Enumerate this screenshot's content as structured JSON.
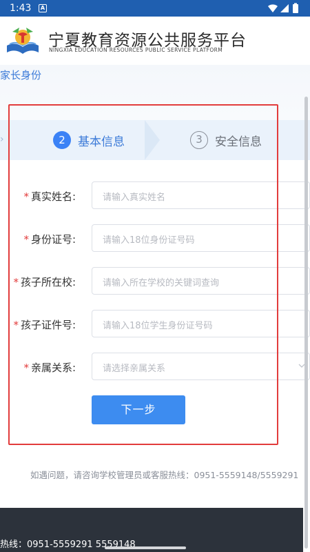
{
  "status_bar": {
    "time": "1:43",
    "notif_icon": "A"
  },
  "header": {
    "title": "宁夏教育资源公共服务平台",
    "subtitle": "NINGXIA EDUCATION RESOURCES PUBLIC SERVICE PLATFORM"
  },
  "breadcrumb": "家长身份",
  "steps": [
    {
      "number": "2",
      "label": "基本信息",
      "active": true
    },
    {
      "number": "3",
      "label": "安全信息",
      "active": false
    }
  ],
  "form": {
    "fields": [
      {
        "label": "真实姓名:",
        "placeholder": "请输入真实姓名",
        "required": true
      },
      {
        "label": "身份证号:",
        "placeholder": "请输入18位身份证号码",
        "required": true
      },
      {
        "label": "孩子所在校:",
        "placeholder": "请输入所在学校的关键词查询",
        "required": true
      },
      {
        "label": "孩子证件号:",
        "placeholder": "请输入18位学生身份证号码",
        "required": true
      },
      {
        "label": "亲属关系:",
        "placeholder": "请选择亲属关系",
        "required": true
      }
    ],
    "next_button": "下一步"
  },
  "help_text": "如遇问题，请咨询学校管理员或客服热线：0951-5559148/5559291",
  "footer_text": "热线：0951-5559291 5559148",
  "colors": {
    "accent": "#3d8cf0",
    "required": "#e23b3b",
    "status_bar": "#1f5fb0",
    "footer": "#2c323b"
  }
}
